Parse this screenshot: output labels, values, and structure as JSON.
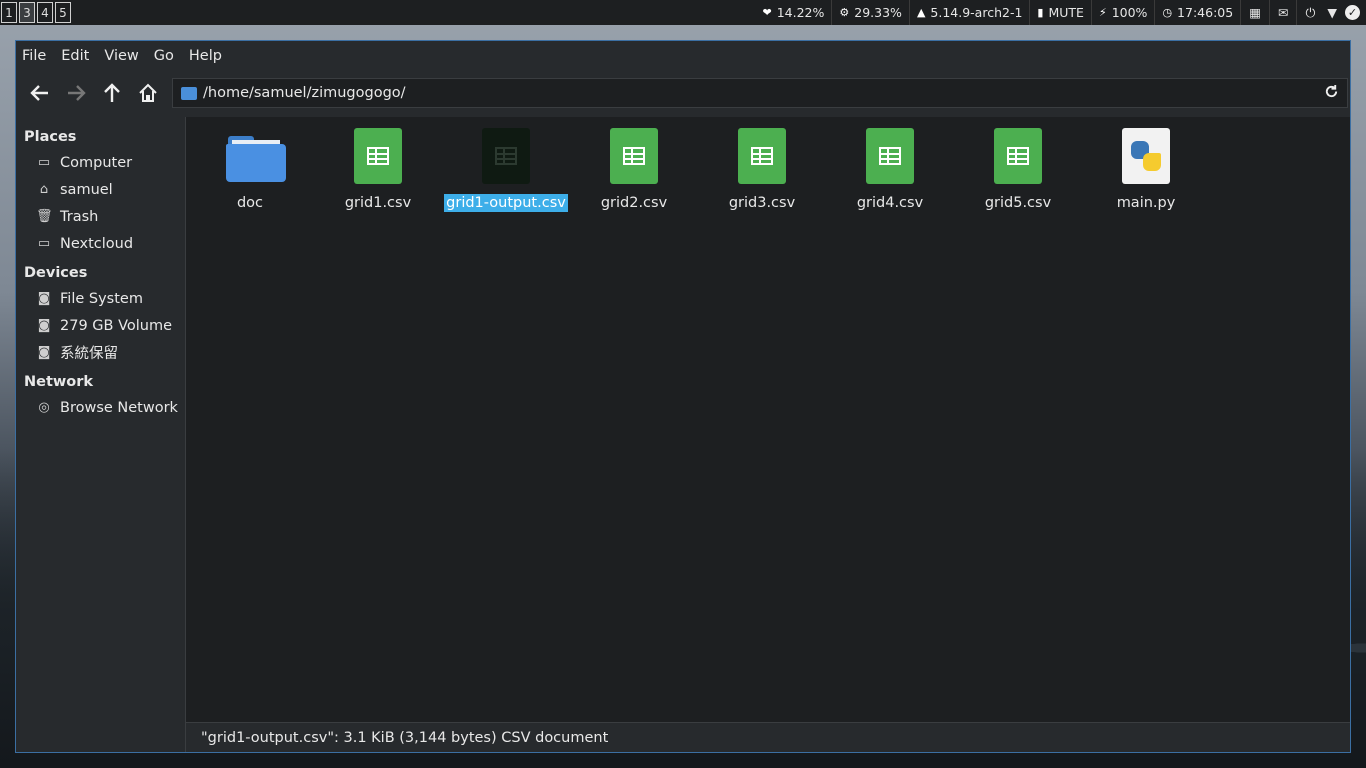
{
  "topbar": {
    "workspaces": [
      "1",
      "3",
      "4",
      "5"
    ],
    "cpu": "14.22%",
    "memory": "29.33%",
    "kernel": "5.14.9-arch2-1",
    "volume": "MUTE",
    "battery": "100%",
    "clock": "17:46:05",
    "icons": [
      "heart-pulse-icon",
      "chip-icon",
      "arch-logo-icon",
      "speaker-icon",
      "plug-icon",
      "clock-icon",
      "grid-icon",
      "mail-icon",
      "power-icon",
      "wifi-icon",
      "check-icon"
    ]
  },
  "window": {
    "menu": [
      "File",
      "Edit",
      "View",
      "Go",
      "Help"
    ],
    "path": "/home/samuel/zimugogogo/",
    "sidebar": {
      "places_header": "Places",
      "places": [
        "Computer",
        "samuel",
        "Trash",
        "Nextcloud"
      ],
      "devices_header": "Devices",
      "devices": [
        "File System",
        "279 GB Volume",
        "系統保留"
      ],
      "network_header": "Network",
      "network": [
        "Browse Network"
      ]
    },
    "files": [
      "doc",
      "grid1.csv",
      "grid1-output.csv",
      "grid2.csv",
      "grid3.csv",
      "grid4.csv",
      "grid5.csv",
      "main.py"
    ],
    "selected_file": "grid1-output.csv",
    "status": "\"grid1-output.csv\": 3.1 KiB (3,144 bytes) CSV document"
  },
  "colors": {
    "accent": "#3daee9",
    "csv_green": "#4caf50",
    "folder_blue": "#4a90e2"
  }
}
